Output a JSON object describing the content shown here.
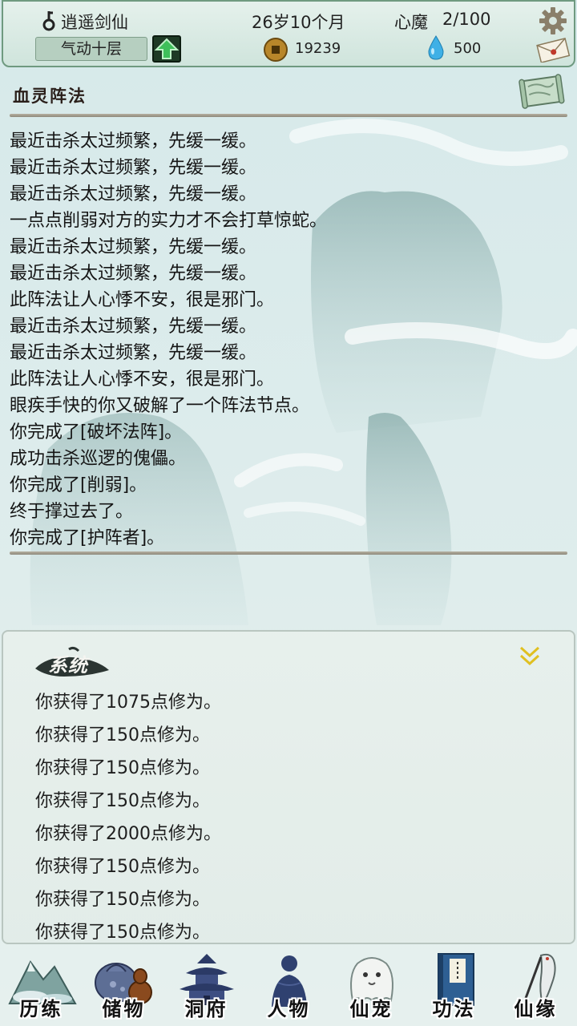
{
  "header": {
    "player_name": "逍遥剑仙",
    "age": "26岁10个月",
    "demon_label": "心魔",
    "demon_value": "2/100",
    "realm": "气动十层",
    "coins": "19239",
    "spirit_stones": "500",
    "icons": [
      "key-icon",
      "level-up-icon",
      "gear-icon",
      "mail-icon",
      "coin-icon",
      "water-drop-icon"
    ]
  },
  "section": {
    "title": "血灵阵法",
    "icon": "scroll-icon"
  },
  "log": [
    "最近击杀太过频繁，先缓一缓。",
    "最近击杀太过频繁，先缓一缓。",
    "最近击杀太过频繁，先缓一缓。",
    "一点点削弱对方的实力才不会打草惊蛇。",
    "最近击杀太过频繁，先缓一缓。",
    "最近击杀太过频繁，先缓一缓。",
    "此阵法让人心悸不安，很是邪门。",
    "最近击杀太过频繁，先缓一缓。",
    "最近击杀太过频繁，先缓一缓。",
    "此阵法让人心悸不安，很是邪门。",
    "眼疾手快的你又破解了一个阵法节点。",
    "你完成了[破坏法阵]。",
    "成功击杀巡逻的傀儡。",
    "你完成了[削弱]。",
    "终于撑过去了。",
    "你完成了[护阵者]。"
  ],
  "system": {
    "title": "系统",
    "collapse_icon": "double-chevron-down-icon",
    "messages": [
      "你获得了1075点修为。",
      "你获得了150点修为。",
      "你获得了150点修为。",
      "你获得了150点修为。",
      "你获得了2000点修为。",
      "你获得了150点修为。",
      "你获得了150点修为。",
      "你获得了150点修为。"
    ]
  },
  "nav": [
    {
      "label": "历练",
      "icon": "mountain-icon"
    },
    {
      "label": "储物",
      "icon": "gourd-bag-icon"
    },
    {
      "label": "洞府",
      "icon": "pagoda-icon"
    },
    {
      "label": "人物",
      "icon": "figure-icon"
    },
    {
      "label": "仙宠",
      "icon": "ghost-pet-icon"
    },
    {
      "label": "功法",
      "icon": "book-icon"
    },
    {
      "label": "仙缘",
      "icon": "crane-icon"
    }
  ],
  "colors": {
    "background": "#d3e6e8",
    "header_border": "#6f9a80",
    "level_up_arrow": "#3fbf5a",
    "collapse_icon": "#e0c020",
    "coin": "#b8862a",
    "spirit_stone": "#3fb0e6"
  }
}
